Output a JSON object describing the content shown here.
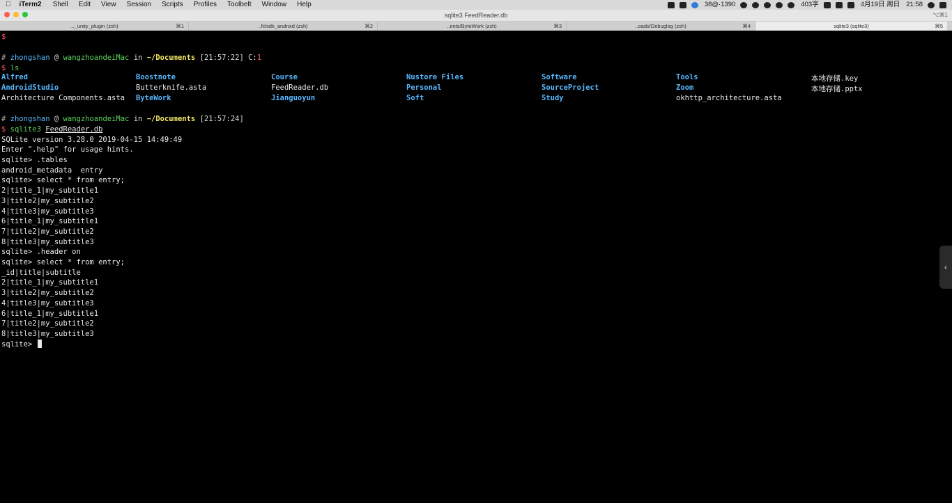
{
  "menubar": {
    "apple": "",
    "app": "iTerm2",
    "items": [
      "Shell",
      "Edit",
      "View",
      "Session",
      "Scripts",
      "Profiles",
      "Toolbelt",
      "Window",
      "Help"
    ],
    "status": {
      "weather": "38@·1390",
      "count": "403字",
      "date": "4月19日 周日",
      "time": "21:58"
    }
  },
  "window": {
    "title": "sqlite3 FeedReader.db",
    "shortcut": "⌥⌘1"
  },
  "tabs": [
    {
      "label": "..._unity_plugin (zsh)",
      "shortcut": "⌘1"
    },
    {
      "label": "..N/sdk_android (zsh)",
      "shortcut": "⌘2"
    },
    {
      "label": "..ents/ByteWork (zsh)",
      "shortcut": "⌘3"
    },
    {
      "label": "..oads/Debuglog (zsh)",
      "shortcut": "⌘4"
    },
    {
      "label": "sqlite3 (sqlite3)",
      "shortcut": "⌘5"
    }
  ],
  "terminal": {
    "first_prompt": "$",
    "prompt1": {
      "hash": "#",
      "user": "zhongshan",
      "at": "@",
      "host": "wangzhoandeiMac",
      "in": "in",
      "dir": "~/Documents",
      "time": "[21:57:22]",
      "code_label": "C:",
      "code": "1"
    },
    "cmd1": {
      "dollar": "$",
      "text": "ls"
    },
    "ls": {
      "col1": [
        "Alfred",
        "AndroidStudio",
        "Architecture Components.asta"
      ],
      "col2": [
        "Boostnote",
        "Butterknife.asta",
        "ByteWork"
      ],
      "col3": [
        "Course",
        "FeedReader.db",
        "Jianguoyun"
      ],
      "col4": [
        "Nustore Files",
        "Personal",
        "Soft"
      ],
      "col5": [
        "Software",
        "SourceProject",
        "Study"
      ],
      "col6": [
        "Tools",
        "Zoom",
        "okhttp_architecture.asta"
      ],
      "col7": [
        "本地存储.key",
        "本地存储.pptx"
      ]
    },
    "prompt2": {
      "hash": "#",
      "user": "zhongshan",
      "at": "@",
      "host": "wangzhoandeiMac",
      "in": "in",
      "dir": "~/Documents",
      "time": "[21:57:24]"
    },
    "cmd2": {
      "dollar": "$",
      "prog": "sqlite3",
      "arg": "FeedReader.db"
    },
    "output": [
      "SQLite version 3.28.0 2019-04-15 14:49:49",
      "Enter \".help\" for usage hints.",
      "sqlite> .tables",
      "android_metadata  entry",
      "sqlite> select * from entry;",
      "2|title_1|my_subtitle1",
      "3|title2|my_subtitle2",
      "4|title3|my_subtitle3",
      "6|title_1|my_subtitle1",
      "7|title2|my_subtitle2",
      "8|title3|my_subtitle3",
      "sqlite> .header on",
      "sqlite> select * from entry;",
      "_id|title|subtitle",
      "2|title_1|my_subtitle1",
      "3|title2|my_subtitle2",
      "4|title3|my_subtitle3",
      "6|title_1|my_subtitle1",
      "7|title2|my_subtitle2",
      "8|title3|my_subtitle3"
    ],
    "current_prompt": "sqlite> "
  }
}
